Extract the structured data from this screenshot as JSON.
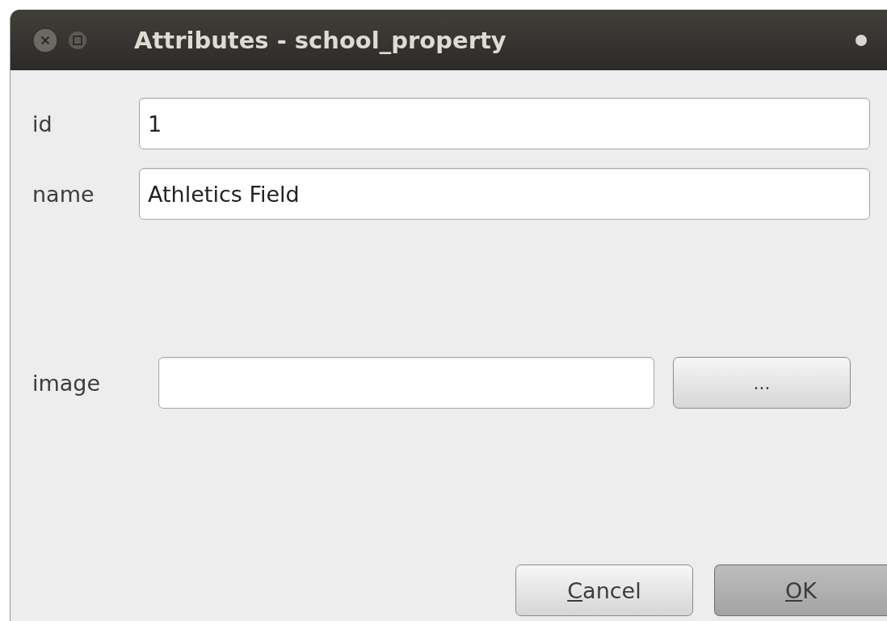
{
  "window": {
    "title": "Attributes - school_property"
  },
  "fields": [
    {
      "label": "id",
      "value": "1",
      "kind": "text"
    },
    {
      "label": "name",
      "value": "Athletics Field",
      "kind": "text"
    },
    {
      "label": "image",
      "kind": "file",
      "button": "..."
    }
  ],
  "buttons": [
    {
      "label": "Cancel",
      "default": false
    },
    {
      "label": "OK",
      "default": true
    }
  ]
}
